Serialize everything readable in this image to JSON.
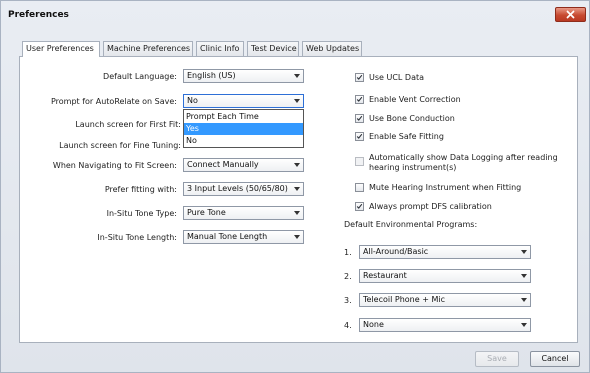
{
  "window": {
    "title": "Preferences"
  },
  "tabs": [
    {
      "label": "User Preferences",
      "active": true
    },
    {
      "label": "Machine Preferences",
      "active": false
    },
    {
      "label": "Clinic Info",
      "active": false
    },
    {
      "label": "Test Device",
      "active": false
    },
    {
      "label": "Web Updates",
      "active": false
    }
  ],
  "left_fields": [
    {
      "label": "Default Language:",
      "value": "English (US)"
    },
    {
      "label": "Prompt for AutoRelate on Save:",
      "value": "No"
    },
    {
      "label": "Launch screen for First Fit:",
      "value": ""
    },
    {
      "label": "Launch screen for Fine Tuning:",
      "value": ""
    },
    {
      "label": "When Navigating to Fit Screen:",
      "value": "Connect Manually"
    },
    {
      "label": "Prefer fitting with:",
      "value": "3 Input Levels (50/65/80)"
    },
    {
      "label": "In-Situ Tone Type:",
      "value": "Pure Tone"
    },
    {
      "label": "In-Situ Tone Length:",
      "value": "Manual Tone Length"
    }
  ],
  "autorelate_dropdown": {
    "options": [
      "Prompt Each Time",
      "Yes",
      "No"
    ],
    "highlighted": "Yes"
  },
  "checkboxes": [
    {
      "label": "Use UCL Data",
      "checked": true,
      "enabled": true
    },
    {
      "label": "Enable Vent Correction",
      "checked": true,
      "enabled": true
    },
    {
      "label": "Use Bone Conduction",
      "checked": true,
      "enabled": true
    },
    {
      "label": "Enable Safe Fitting",
      "checked": true,
      "enabled": true
    },
    {
      "label": "Automatically show Data Logging after reading hearing instrument(s)",
      "checked": false,
      "enabled": false
    },
    {
      "label": "Mute Hearing Instrument when Fitting",
      "checked": false,
      "enabled": true
    },
    {
      "label": "Always prompt DFS calibration",
      "checked": true,
      "enabled": true
    }
  ],
  "programs": {
    "heading": "Default Environmental Programs:",
    "items": [
      {
        "num": "1.",
        "value": "All-Around/Basic"
      },
      {
        "num": "2.",
        "value": "Restaurant"
      },
      {
        "num": "3.",
        "value": "Telecoil Phone + Mic"
      },
      {
        "num": "4.",
        "value": "None"
      }
    ]
  },
  "footer": {
    "save_label": "Save",
    "cancel_label": "Cancel",
    "save_enabled": false
  },
  "colors": {
    "highlight": "#3399ff",
    "close_button": "#c74a31"
  }
}
